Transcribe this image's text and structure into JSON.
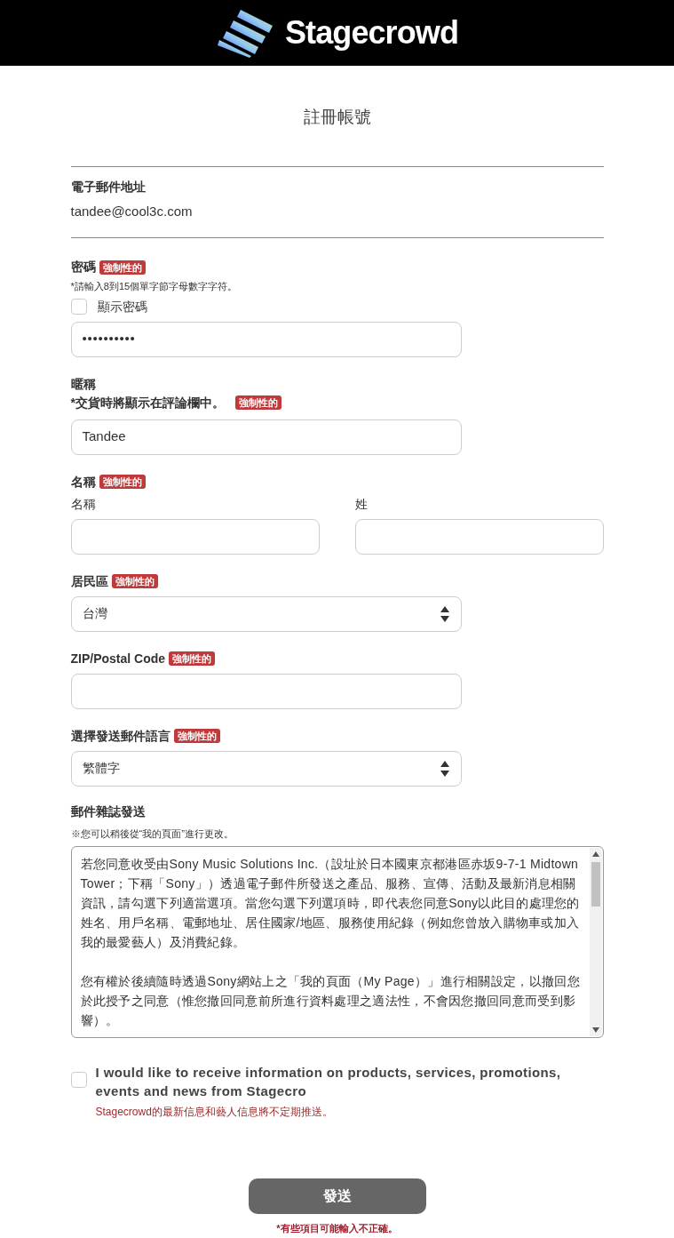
{
  "header": {
    "logo_text": "Stagecrowd"
  },
  "title": "註冊帳號",
  "email": {
    "label": "電子郵件地址",
    "value": "tandee@cool3c.com"
  },
  "fields": [
    {
      "kind": "password",
      "label": "密碼",
      "badge": "強制性的",
      "hint": "*請輸入8到15個單字節字母數字字符。",
      "show_password": {
        "label": "顯示密碼",
        "checked": false
      },
      "value": "••••••••••"
    },
    {
      "kind": "text",
      "label": "暱稱",
      "hint": "*交貨時將顯示在評論欄中。",
      "badge": "強制性的",
      "value": "Tandee"
    },
    {
      "kind": "name",
      "label": "名稱",
      "badge": "強制性的",
      "parts": [
        {
          "label": "名稱"
        },
        {
          "label": "姓"
        }
      ]
    },
    {
      "kind": "select",
      "label": "居民區",
      "badge": "強制性的",
      "value": "台灣"
    },
    {
      "kind": "text",
      "label": "ZIP/Postal Code",
      "badge": "強制性的"
    },
    {
      "kind": "select",
      "label": "選擇發送郵件語言",
      "badge": "強制性的",
      "value": "繁體字"
    }
  ],
  "newsletter": {
    "label": "郵件雜誌發送",
    "note": "※您可以稍後從“我的頁面”進行更改。",
    "terms": [
      "若您同意收受由Sony Music Solutions Inc.（設址於日本國東京都港區赤坂9-7-1 Midtown Tower；下稱「Sony」）透過電子郵件所發送之產品、服務、宣傳、活動及最新消息相關資訊，請勾選下列適當選項。當您勾選下列選項時，即代表您同意Sony以此目的處理您的姓名、用戶名稱、電郵地址、居住國家/地區、服務使用紀錄（例如您曾放入購物車或加入我的最愛藝人）及消費紀錄。",
      "您有權於後續隨時透過Sony網站上之「我的頁面（My Page）」進行相關設定，以撤回您於此授予之同意（惟您撤回同意前所進行資料處理之適法性，不會因您撤回同意而受到影響）。"
    ],
    "opt_in": {
      "label": "I would like to receive information on products, services, promotions, events and news from Stagecro",
      "note": "Stagecrowd的最新信息和藝人信息將不定期推送。",
      "checked": false
    }
  },
  "submit": {
    "label": "發送",
    "error": "*有些項目可能輸入不正確。"
  }
}
